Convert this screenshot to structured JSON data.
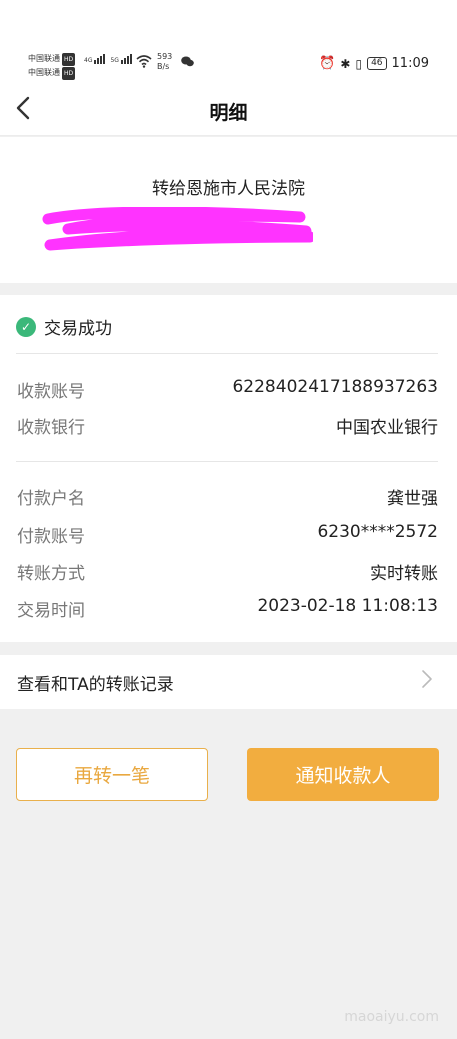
{
  "status_bar": {
    "carrier_1": "中国联通",
    "carrier_2": "中国联通",
    "hd": "HD",
    "net_1": "4G",
    "net_2": "5G",
    "speed_value": "593",
    "speed_unit": "B/s",
    "battery": "46",
    "time": "11:09"
  },
  "nav": {
    "title": "明细"
  },
  "header": {
    "recipient": "转给恩施市人民法院"
  },
  "detail": {
    "status": "交易成功",
    "group1": [
      {
        "key": "收款账号",
        "value": "6228402417188937263"
      },
      {
        "key": "收款银行",
        "value": "中国农业银行"
      }
    ],
    "group2": [
      {
        "key": "付款户名",
        "value": "龚世强"
      },
      {
        "key": "付款账号",
        "value": "6230****2572"
      },
      {
        "key": "转账方式",
        "value": "实时转账"
      },
      {
        "key": "交易时间",
        "value": "2023-02-18 11:08:13"
      }
    ]
  },
  "history_link": {
    "label": "查看和TA的转账记录"
  },
  "buttons": {
    "again": "再转一笔",
    "notify": "通知收款人"
  },
  "watermark": "maoaiyu.com",
  "colors": {
    "accent": "#f2ad3f",
    "success": "#3bb87a",
    "mask": "#ff33ff"
  }
}
